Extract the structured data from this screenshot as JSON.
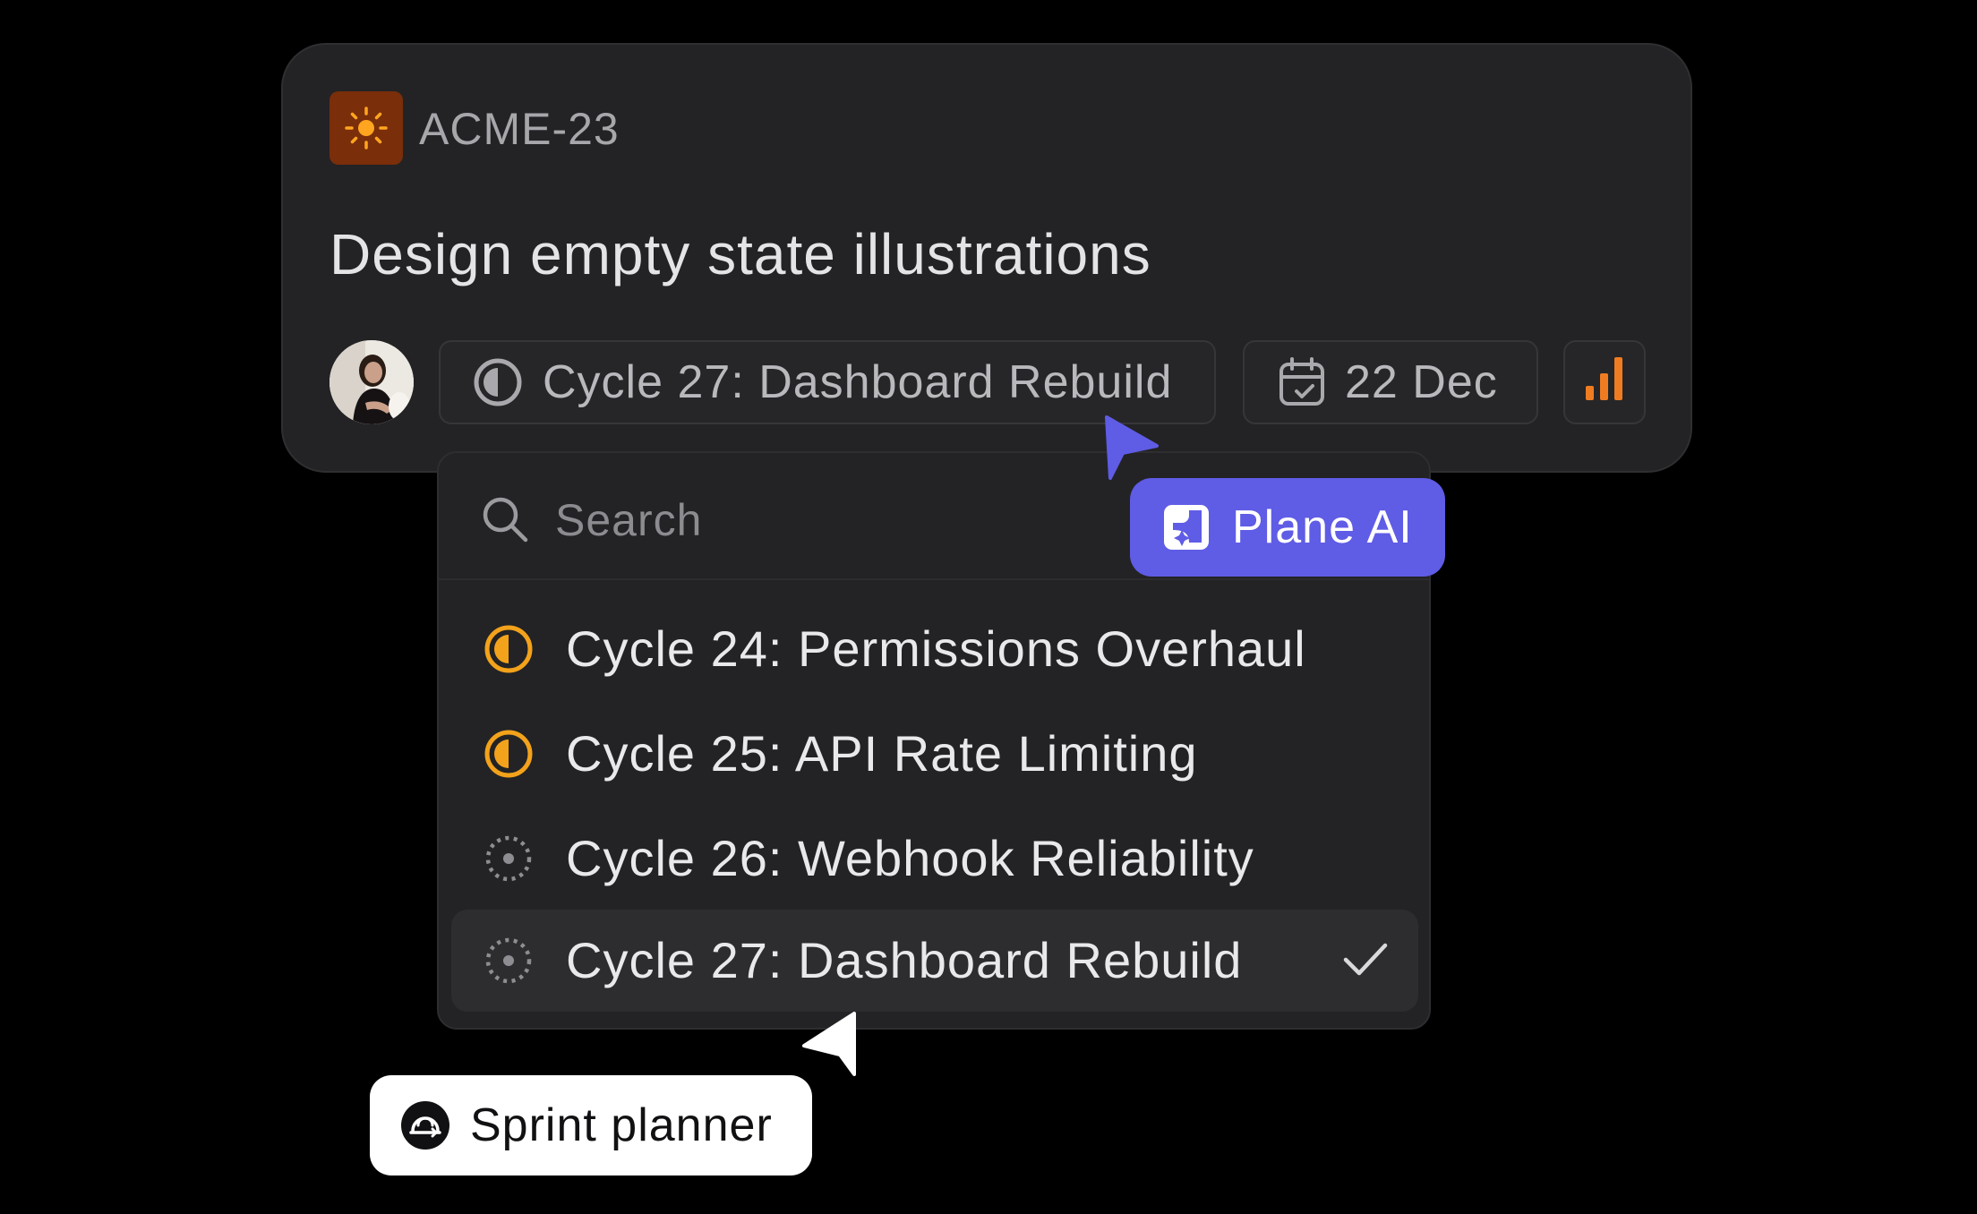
{
  "issue": {
    "id": "ACME-23",
    "title": "Design empty state illustrations",
    "icon": "sun-icon",
    "icon_bg": "#7a2e0a",
    "icon_color": "#ffa51f",
    "cycle": "Cycle 27: Dashboard Rebuild",
    "due_date": "22 Dec",
    "priority_color": "#f07c22"
  },
  "dropdown": {
    "search_placeholder": "Search",
    "options": [
      {
        "label": "Cycle 24: Permissions Overhaul",
        "status": "in-progress",
        "icon": "half-circle-icon",
        "selected": false
      },
      {
        "label": "Cycle 25: API Rate Limiting",
        "status": "in-progress",
        "icon": "half-circle-icon",
        "selected": false
      },
      {
        "label": "Cycle 26: Webhook Reliability",
        "status": "upcoming",
        "icon": "dotted-circle-icon",
        "selected": false
      },
      {
        "label": "Cycle 27: Dashboard Rebuild",
        "status": "upcoming",
        "icon": "dotted-circle-icon",
        "selected": true
      }
    ]
  },
  "tags": {
    "plane_ai": "Plane AI",
    "sprint_planner": "Sprint planner"
  },
  "colors": {
    "accent": "#5f5ce6",
    "in_progress": "#f3a21b",
    "background": "#000000",
    "card": "#232325"
  }
}
